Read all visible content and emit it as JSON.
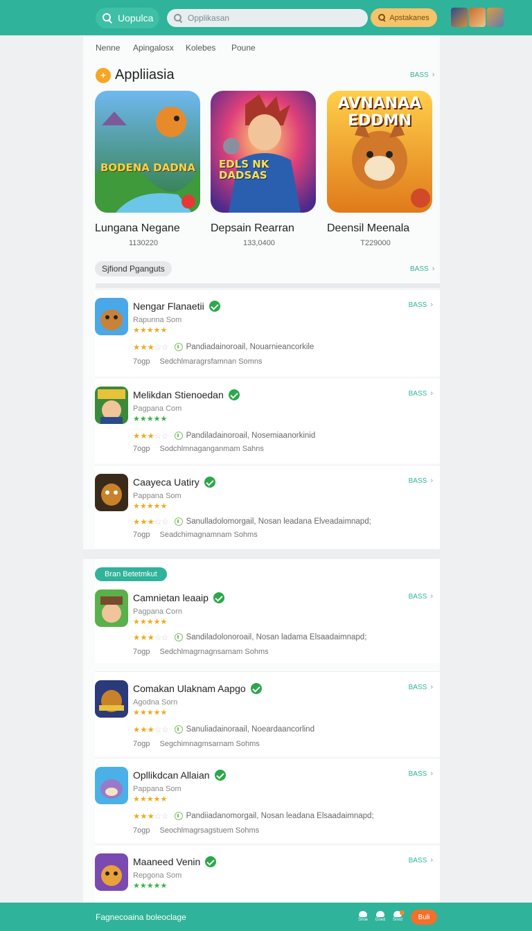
{
  "topbar": {
    "brand": "Uopulca",
    "search_placeholder": "Opplikasan",
    "apps_button": "Apstakanes"
  },
  "nav": [
    "Nenne",
    "Apingalosx",
    "Kolebes",
    "Poune"
  ],
  "featured": {
    "title": "Appliiasia",
    "more": "BASS",
    "items": [
      {
        "name": "Lungana Negane",
        "value": "1130220",
        "art_text": "BODENA DADNA"
      },
      {
        "name": "Depsain Rearran",
        "value": "133,0400",
        "art_text": "EDLS NK DADSAS"
      },
      {
        "name": "Deensil Meenala",
        "value": "T229000",
        "art_text": "AVNANAA EDDMN"
      }
    ]
  },
  "section2": {
    "pill": "Sjfiond Pganguts",
    "more": "BASS"
  },
  "apps": [
    {
      "title": "Nengar Flanaetii",
      "dev": "Rapunna Som",
      "stars": "★★★★★",
      "stars_green": false,
      "rating": "★★★☆☆",
      "desc": "Pandiadainoroail, Nouarnieancorkile",
      "age": "7ogp",
      "foot": "Sedchlmaragrsfamnan Somns",
      "more": "BASS"
    },
    {
      "title": "Melikdan Stienoedan",
      "dev": "Pagpana Com",
      "stars": "★★★★★",
      "stars_green": true,
      "rating": "★★★☆☆",
      "desc": "Pandiladainoroail, Nosemiaanorkinid",
      "age": "7ogp",
      "foot": "Sodchlmnaganganmam Sahns",
      "more": "BASS"
    },
    {
      "title": "Caayeca Uatiry",
      "dev": "Pappana Som",
      "stars": "★★★★★",
      "stars_green": false,
      "rating": "★★★☆☆",
      "desc": "Sanulladolomorgail, Nosan leadana Elveadaimnapd;",
      "age": "7ogp",
      "foot": "Seadchimagnamnam Sohms",
      "more": "BASS"
    },
    {
      "title": "Camnietan leaaip",
      "dev": "Pagpana Corn",
      "stars": "★★★★★",
      "stars_green": false,
      "rating": "★★★☆☆",
      "desc": "Sandiladolonoroail, Nosan ladama Elsaadaimnapd;",
      "age": "7ogp",
      "foot": "Sedchlmagrnagnsarnam Sohms",
      "more": "BASS"
    },
    {
      "title": "Comakan Ulaknam Aapgo",
      "dev": "Agodna Sorn",
      "stars": "★★★★★",
      "stars_green": false,
      "rating": "★★★☆☆",
      "desc": "Sanuliadainoraail, Noeardaancorlind",
      "age": "7ogp",
      "foot": "Segchimnagmsarnam Sohms",
      "more": "BASS"
    },
    {
      "title": "Opllikdcan Allaian",
      "dev": "Pappana Som",
      "stars": "★★★★★",
      "stars_green": false,
      "rating": "★★★☆☆",
      "desc": "Pandiiadanomorgail, Nosan leadana Elsaadaimnapd;",
      "age": "7ogp",
      "foot": "Seochlmagrsagstuem Sohms",
      "more": "BASS"
    },
    {
      "title": "Maaneed Venin",
      "dev": "Repgona Som",
      "stars": "★★★★★",
      "stars_green": true,
      "more": "BASS"
    }
  ],
  "badge": "Bran Betetmkut",
  "bottombar": {
    "text": "Fagnecoaina boleoclage",
    "buy": "Buli",
    "icons": [
      "Snoe",
      "Goed",
      "Sned"
    ]
  },
  "colors": {
    "accent": "#2fb39a",
    "orange": "#f0702c",
    "star": "#f0a91f",
    "verified": "#2aa84a"
  }
}
